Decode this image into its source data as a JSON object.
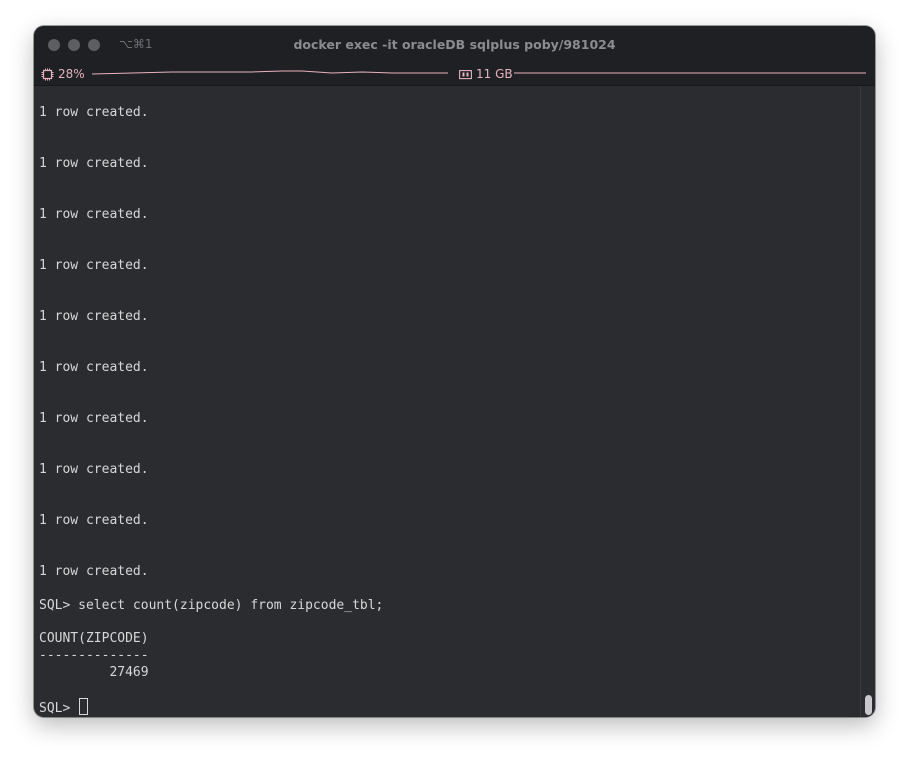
{
  "window": {
    "title": "docker exec -it oracleDB sqlplus poby/981024",
    "shortcut": "⌥⌘1"
  },
  "status": {
    "cpu_label": "28%",
    "mem_label": "11 GB"
  },
  "terminal": {
    "lines": [
      "1 row created.",
      "1 row created.",
      "1 row created.",
      "1 row created.",
      "1 row created.",
      "1 row created.",
      "1 row created.",
      "1 row created.",
      "1 row created.",
      "1 row created.",
      "SQL> select count(zipcode) from zipcode_tbl;",
      "COUNT(ZIPCODE)",
      "--------------",
      "         27469",
      "SQL> "
    ]
  },
  "colors": {
    "window_bg": "#2b2c30",
    "titlebar_bg": "#1f2024",
    "text": "#d7d7d7",
    "status_accent": "#e6b3bd"
  },
  "icons": {
    "cpu": "cpu-chip-icon",
    "memory": "memory-icon"
  }
}
